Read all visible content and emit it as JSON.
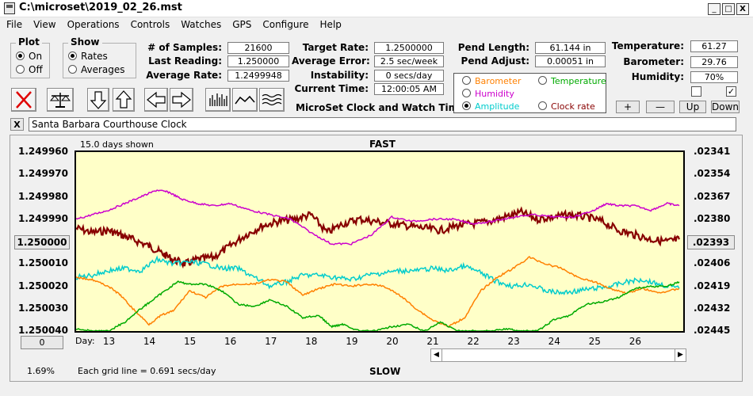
{
  "window": {
    "title": "C:\\microset\\2019_02_26.mst",
    "minimize": "_",
    "maximize": "□",
    "close": "X"
  },
  "menu": [
    "File",
    "View",
    "Operations",
    "Controls",
    "Watches",
    "GPS",
    "Configure",
    "Help"
  ],
  "plot_group": {
    "title": "Plot",
    "on": "On",
    "off": "Off",
    "selected": "On"
  },
  "show_group": {
    "title": "Show",
    "rates": "Rates",
    "averages": "Averages",
    "selected": "Rates"
  },
  "stats": {
    "samples_label": "# of Samples:",
    "samples": "21600",
    "last_label": "Last Reading:",
    "last": "1.250000",
    "avg_label": "Average Rate:",
    "avg": "1.2499948",
    "target_label": "Target Rate:",
    "target": "1.2500000",
    "error_label": "Average Error:",
    "error": "2.5 sec/week",
    "instab_label": "Instability:",
    "instab": "0 secs/day",
    "time_label": "Current Time:",
    "time": "12:00:05 AM",
    "app_name": "MicroSet Clock and Watch Timer",
    "pend_len_label": "Pend Length:",
    "pend_len": "61.144 in",
    "pend_adj_label": "Pend Adjust:",
    "pend_adj": "0.00051 in",
    "temp_label": "Temperature:",
    "temp": "61.27",
    "baro_label": "Barometer:",
    "baro": "29.76",
    "hum_label": "Humidity:",
    "hum": "70%"
  },
  "overlay_options": {
    "barometer": "Barometer",
    "temperature": "Temperature",
    "humidity": "Humidity",
    "amplitude": "Amplitude",
    "clock_rate": "Clock rate",
    "selected": "Amplitude",
    "colors": {
      "barometer": "#ff8000",
      "temperature": "#00aa00",
      "humidity": "#cc00cc",
      "amplitude": "#00cccc",
      "clock_rate": "#880000"
    }
  },
  "adjust_buttons": {
    "plus": "+",
    "minus": "—",
    "up": "Up",
    "down": "Down"
  },
  "check_left": "",
  "check_right": "✓",
  "clock_name": "Santa Barbara Courthouse Clock",
  "clock_close": "X",
  "chart": {
    "days_shown": "15.0 days shown",
    "fast": "FAST",
    "slow": "SLOW",
    "grid_note": "Each grid line = 0.691 secs/day",
    "left_pct": "1.69%",
    "day_label": "Day:",
    "center_button": "1.250000",
    "right_center_button": ".02393",
    "bottom_left_button": "0"
  },
  "chart_data": {
    "type": "line",
    "x_unit": "day",
    "xlim": [
      12.2,
      27.2
    ],
    "x_ticks": [
      "13",
      "14",
      "15",
      "16",
      "17",
      "18",
      "19",
      "20",
      "21",
      "22",
      "23",
      "24",
      "25",
      "26"
    ],
    "left_axis_ticks": [
      "1.249960",
      "1.249970",
      "1.249980",
      "1.249990",
      "1.250000",
      "1.250010",
      "1.250020",
      "1.250030",
      "1.250040"
    ],
    "left_ylim": [
      1.24996,
      1.25004
    ],
    "right_axis_ticks": [
      ".02341",
      ".02354",
      ".02367",
      ".02380",
      ".02393",
      ".02406",
      ".02419",
      ".02432",
      ".02445"
    ],
    "right_ylim": [
      0.02341,
      0.02445
    ],
    "series": [
      {
        "name": "Clock rate",
        "color": "#880000",
        "width": 2.2,
        "x": [
          12.2,
          12.6,
          13,
          13.3,
          13.6,
          14,
          14.3,
          14.6,
          14.9,
          15.2,
          15.6,
          16,
          16.4,
          16.8,
          17.2,
          17.6,
          18,
          18.4,
          18.8,
          19.2,
          19.6,
          20,
          20.4,
          20.8,
          21.2,
          21.6,
          22,
          22.4,
          22.8,
          23.2,
          23.6,
          24,
          24.4,
          24.8,
          25.2,
          25.6,
          26,
          26.4,
          26.8,
          27.1
        ],
        "y": [
          1.249994,
          1.249996,
          1.249995,
          1.249997,
          1.249999,
          1.250002,
          1.250005,
          1.250008,
          1.25001,
          1.250008,
          1.250007,
          1.250002,
          1.249997,
          1.249993,
          1.249991,
          1.24999,
          1.249988,
          1.249996,
          1.249992,
          1.24999,
          1.249991,
          1.249992,
          1.249993,
          1.249994,
          1.249995,
          1.249993,
          1.249992,
          1.249991,
          1.249989,
          1.249987,
          1.24999,
          1.249989,
          1.249988,
          1.249989,
          1.249991,
          1.249995,
          1.249997,
          1.249999,
          1.25,
          1.249999
        ]
      },
      {
        "name": "Humidity",
        "color": "#cc00cc",
        "width": 1.5,
        "x": [
          12.2,
          12.6,
          13,
          13.4,
          13.8,
          14.2,
          14.5,
          14.8,
          15.2,
          15.6,
          16,
          16.5,
          17,
          17.5,
          18,
          18.5,
          19,
          19.5,
          20,
          20.5,
          21,
          21.5,
          22,
          22.5,
          23,
          23.5,
          24,
          24.5,
          25,
          25.3,
          25.6,
          26,
          26.4,
          26.8,
          27.1
        ],
        "y": [
          1.24999,
          1.249988,
          1.249986,
          1.249983,
          1.24998,
          1.249977,
          1.249978,
          1.249981,
          1.249983,
          1.249984,
          1.249983,
          1.249986,
          1.249988,
          1.24999,
          1.249996,
          1.250001,
          1.250001,
          1.249997,
          1.249989,
          1.249991,
          1.24999,
          1.24999,
          1.249992,
          1.249991,
          1.249989,
          1.249988,
          1.249989,
          1.249989,
          1.249986,
          1.249983,
          1.249984,
          1.249984,
          1.249986,
          1.249983,
          1.249984
        ]
      },
      {
        "name": "Amplitude",
        "color": "#00cccc",
        "width": 1.5,
        "x": [
          12.2,
          12.6,
          13,
          13.4,
          13.8,
          14.2,
          14.6,
          15,
          15.4,
          15.8,
          16.2,
          16.6,
          17,
          17.4,
          17.8,
          18.2,
          18.6,
          19,
          19.4,
          19.8,
          20.2,
          20.6,
          21,
          21.4,
          21.8,
          22.2,
          22.6,
          23,
          23.4,
          23.8,
          24.2,
          24.6,
          25,
          25.4,
          25.8,
          26.2,
          26.6,
          27.1
        ],
        "y": [
          1.250016,
          1.250015,
          1.250013,
          1.250012,
          1.250013,
          1.250008,
          1.25001,
          1.250009,
          1.25001,
          1.250012,
          1.250012,
          1.250016,
          1.25002,
          1.250018,
          1.250015,
          1.250015,
          1.250016,
          1.250017,
          1.250015,
          1.250014,
          1.250013,
          1.250013,
          1.250012,
          1.250013,
          1.250011,
          1.250014,
          1.250018,
          1.25002,
          1.250019,
          1.250022,
          1.250023,
          1.250022,
          1.250021,
          1.25002,
          1.250018,
          1.250017,
          1.250019,
          1.250021
        ]
      },
      {
        "name": "Barometer",
        "color": "#ff8000",
        "width": 1.5,
        "x": [
          12.2,
          12.6,
          13,
          13.3,
          13.6,
          14,
          14.3,
          14.6,
          15,
          15.4,
          15.8,
          16.2,
          16.6,
          17,
          17.4,
          17.8,
          18.2,
          18.6,
          19,
          19.4,
          19.8,
          20.2,
          20.6,
          21,
          21.4,
          21.8,
          22.2,
          22.6,
          23,
          23.4,
          23.8,
          24.2,
          24.6,
          25,
          25.4,
          25.8,
          26.2,
          26.6,
          27.1
        ],
        "y": [
          1.250016,
          1.250017,
          1.25002,
          1.250024,
          1.25003,
          1.250037,
          1.250033,
          1.250031,
          1.250022,
          1.250025,
          1.25002,
          1.250019,
          1.250019,
          1.250017,
          1.250018,
          1.250024,
          1.250021,
          1.250019,
          1.25002,
          1.250019,
          1.25002,
          1.250024,
          1.25003,
          1.250035,
          1.250038,
          1.250034,
          1.250022,
          1.250016,
          1.250012,
          1.250007,
          1.25001,
          1.250012,
          1.250016,
          1.250018,
          1.250021,
          1.250023,
          1.250021,
          1.250023,
          1.250021
        ]
      },
      {
        "name": "Temperature",
        "color": "#00aa00",
        "width": 1.5,
        "x": [
          12.2,
          12.6,
          13,
          13.4,
          13.8,
          14.1,
          14.4,
          14.7,
          15,
          15.4,
          15.8,
          16.2,
          16.6,
          17,
          17.4,
          17.8,
          18.2,
          18.5,
          18.8,
          19.2,
          19.6,
          20,
          20.4,
          20.8,
          21.2,
          21.6,
          22,
          22.4,
          22.8,
          23.2,
          23.6,
          24,
          24.4,
          24.8,
          25.2,
          25.6,
          26,
          26.4,
          26.8,
          27.1
        ],
        "y": [
          1.250039,
          1.25004,
          1.25004,
          1.250036,
          1.25003,
          1.250026,
          1.250022,
          1.250018,
          1.250019,
          1.250019,
          1.250022,
          1.250028,
          1.250029,
          1.250026,
          1.250029,
          1.250034,
          1.250033,
          1.250038,
          1.250037,
          1.25004,
          1.25004,
          1.250038,
          1.250037,
          1.25004,
          1.250036,
          1.25004,
          1.25004,
          1.25004,
          1.250039,
          1.25004,
          1.25004,
          1.250035,
          1.250033,
          1.250028,
          1.250027,
          1.250025,
          1.250021,
          1.25002,
          1.25002,
          1.250018
        ]
      }
    ]
  }
}
